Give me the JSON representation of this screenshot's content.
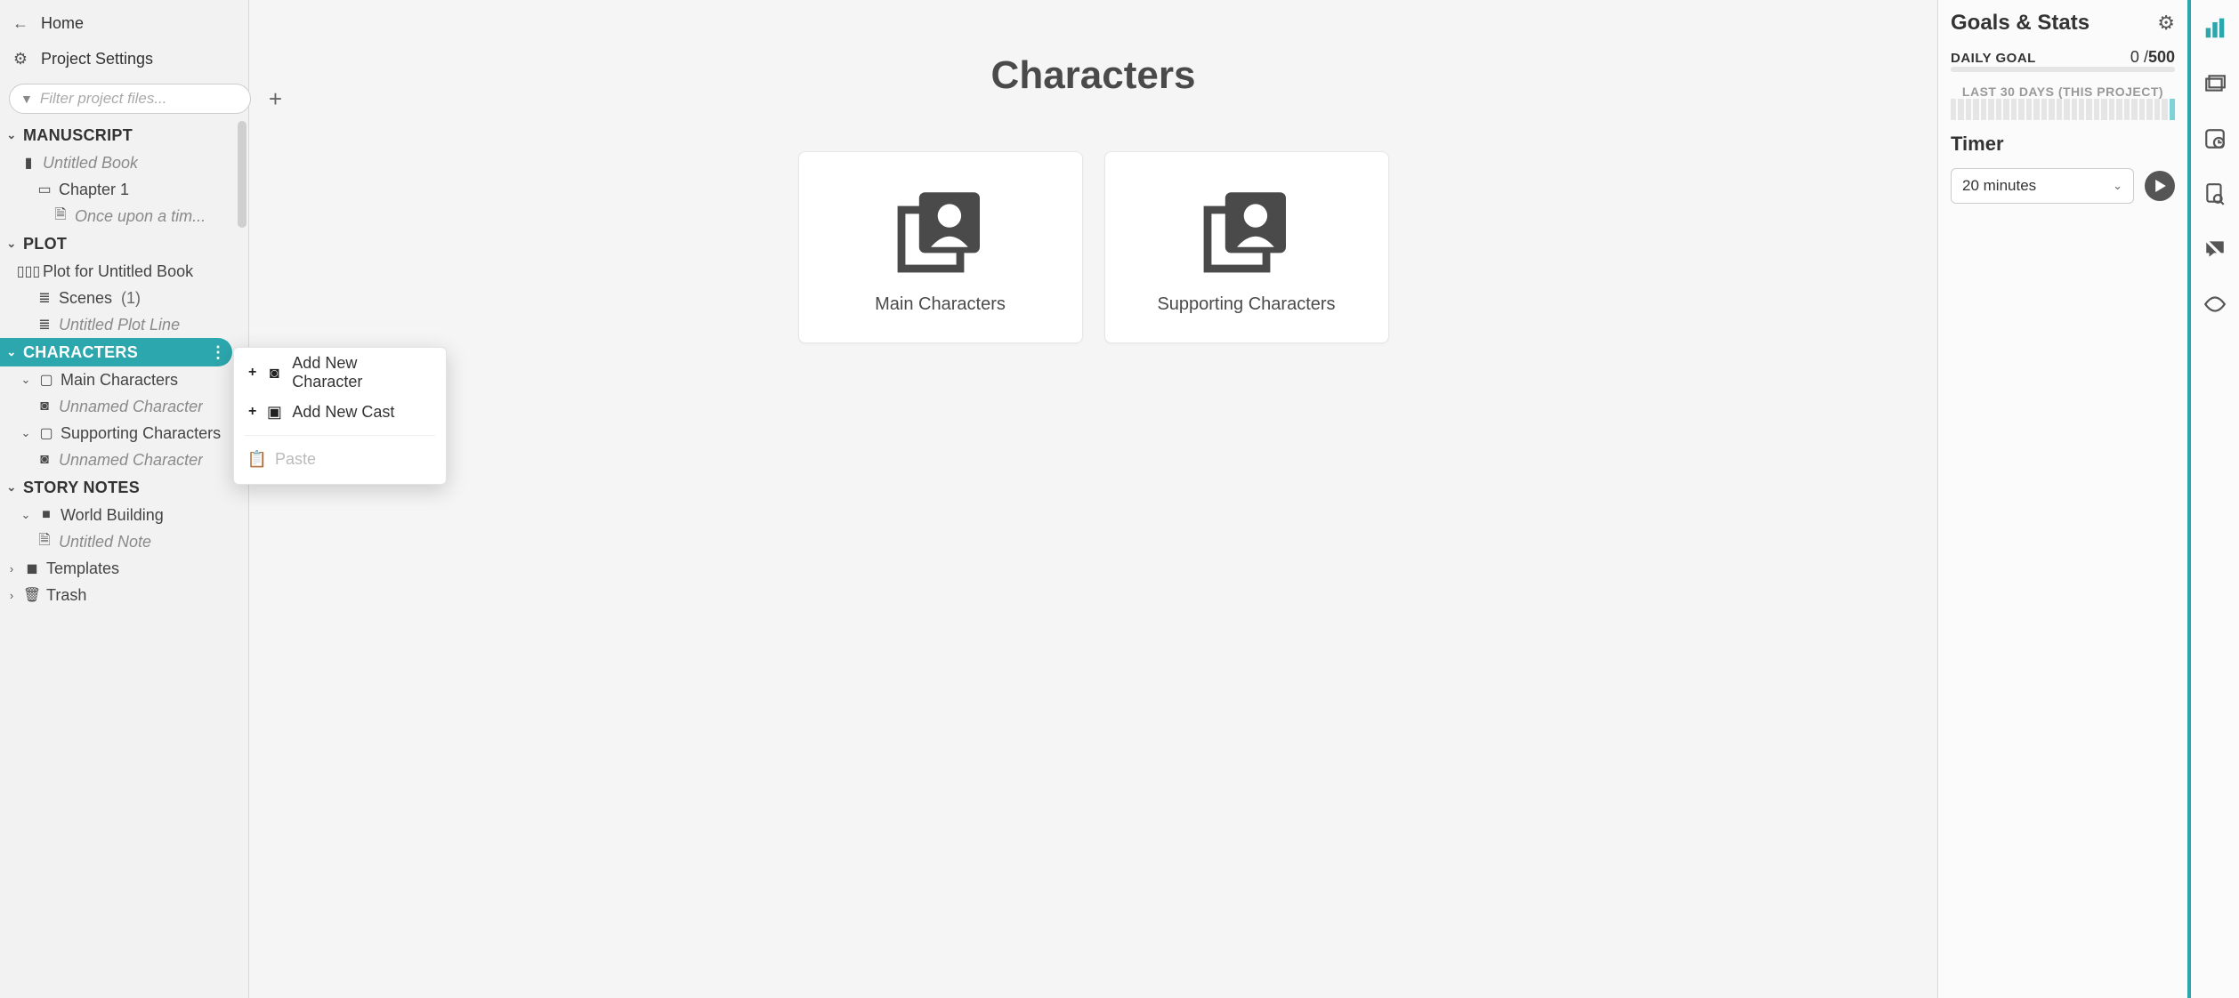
{
  "nav": {
    "home_label": "Home",
    "project_settings_label": "Project Settings",
    "filter_placeholder": "Filter project files..."
  },
  "tree": {
    "manuscript": {
      "heading": "Manuscript",
      "book": "Untitled Book",
      "chapter": "Chapter 1",
      "scene": "Once upon a tim..."
    },
    "plot": {
      "heading": "Plot",
      "plot_for": "Plot for Untitled Book",
      "scenes_label": "Scenes",
      "scenes_count": "(1)",
      "plot_line": "Untitled Plot Line"
    },
    "characters": {
      "heading": "Characters",
      "main": "Main Characters",
      "main_unnamed": "Unnamed Character",
      "supporting": "Supporting Characters",
      "supporting_unnamed": "Unnamed Character"
    },
    "story_notes": {
      "heading": "Story Notes",
      "world_building": "World Building",
      "untitled_note": "Untitled Note"
    },
    "templates": "Templates",
    "trash": "Trash"
  },
  "context_menu": {
    "add_character": "Add New Character",
    "add_cast": "Add New Cast",
    "paste": "Paste"
  },
  "main": {
    "title": "Characters",
    "cards": {
      "main": "Main Characters",
      "supporting": "Supporting Characters"
    }
  },
  "right": {
    "title": "Goals & Stats",
    "daily_goal_label": "DAILY GOAL",
    "daily_goal_current": "0",
    "daily_goal_sep": " /",
    "daily_goal_target": "500",
    "last30_label": "LAST 30 DAYS (THIS PROJECT)",
    "timer_label": "Timer",
    "timer_value": "20 minutes"
  }
}
